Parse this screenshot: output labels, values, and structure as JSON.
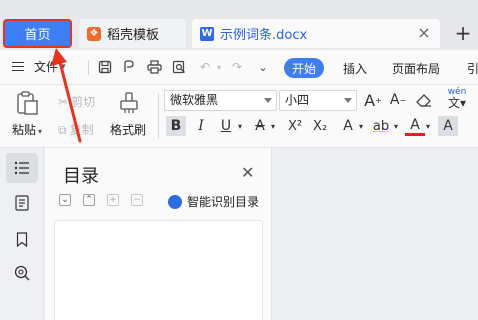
{
  "tabs": {
    "home": "首页",
    "template": "稻壳模板",
    "doc": "示例词条.docx",
    "template_icon": "daoke-icon",
    "doc_icon": "wps-w-icon"
  },
  "menu": {
    "file": "文件",
    "start": "开始",
    "insert": "插入",
    "layout": "页面布局",
    "cut_off": "引"
  },
  "ribbon": {
    "paste": "粘贴",
    "cut": "剪切",
    "copy": "复制",
    "format_painter": "格式刷",
    "font": "微软雅黑",
    "size": "小四",
    "bold": "B",
    "italic": "I",
    "underline": "U",
    "strike": "A",
    "superscript": "X²",
    "subscript": "X₂",
    "text_effect": "A",
    "highlight": "ab",
    "font_color": "A",
    "char_shade": "A",
    "grow": "A",
    "shrink": "A",
    "phonetic": "wén"
  },
  "toc": {
    "title": "目录",
    "smart": "智能识别目录"
  },
  "colors": {
    "accent": "#3d7ef5",
    "annotation": "#e8331f"
  }
}
